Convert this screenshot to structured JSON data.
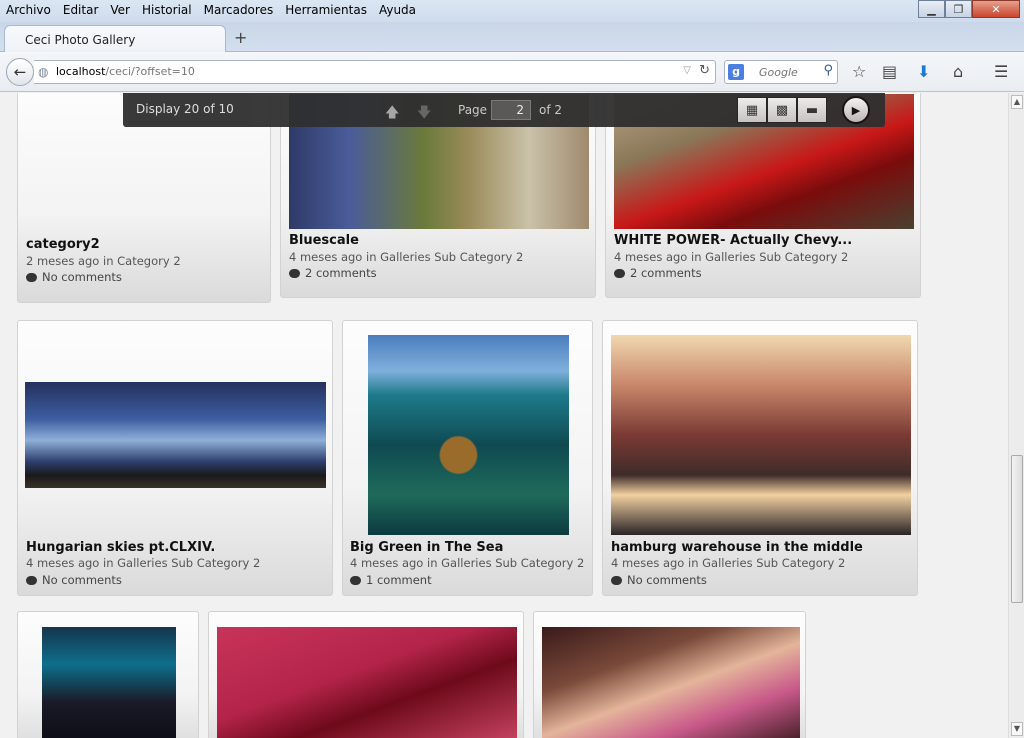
{
  "menu": [
    "Archivo",
    "Editar",
    "Ver",
    "Historial",
    "Marcadores",
    "Herramientas",
    "Ayuda"
  ],
  "tab": {
    "title": "Ceci Photo Gallery",
    "new_tab": "+"
  },
  "url": {
    "host": "localhost",
    "path": "/ceci/?offset=10"
  },
  "search": {
    "engine": "g",
    "placeholder": "Google"
  },
  "gallery_bar": {
    "display": "Display 20 of 10",
    "page_label": "Page :",
    "page_value": "2",
    "of_label": "of 2"
  },
  "cards": [
    {
      "title": "category2",
      "meta": "2 meses ago in Category 2",
      "comments": "No comments"
    },
    {
      "title": "Bluescale",
      "meta": "4 meses ago in Galleries Sub Category 2",
      "comments": "2 comments"
    },
    {
      "title": "WHITE POWER- Actually Chevy...",
      "meta": "4 meses ago in Galleries Sub Category 2",
      "comments": "2 comments"
    },
    {
      "title": "Hungarian skies pt.CLXIV.",
      "meta": "4 meses ago in Galleries Sub Category 2",
      "comments": "No comments"
    },
    {
      "title": "Big Green in The Sea",
      "meta": "4 meses ago in Galleries Sub Category 2",
      "comments": "1 comment"
    },
    {
      "title": "hamburg warehouse in the middle",
      "meta": "4 meses ago in Galleries Sub Category 2",
      "comments": "No comments"
    }
  ]
}
